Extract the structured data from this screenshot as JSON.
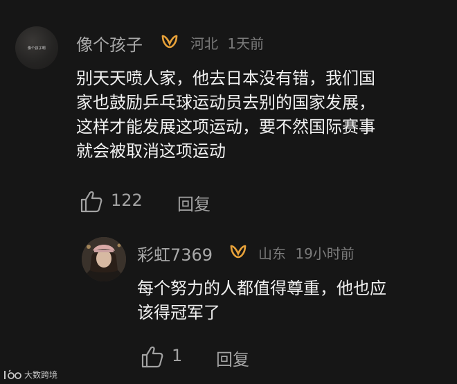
{
  "comment": {
    "username": "像个孩子",
    "location": "河北",
    "time": "1天前",
    "avatar_caption": "像个孩子啊",
    "text_lines": [
      "别天天喷人家，他去日本没有错，我们国",
      "家也鼓励乒乓球运动员去别的国家发展，",
      "这样才能发展这项运动，要不然国际赛事",
      "就会被取消这项运动"
    ],
    "like_count": "122",
    "reply_label": "回复"
  },
  "reply": {
    "username": "彩虹7369",
    "location": "山东",
    "time": "19小时前",
    "text_lines": [
      "每个努力的人都值得尊重，他也应",
      "该得冠军了"
    ],
    "like_count": "1",
    "reply_label": "回复"
  },
  "watermark": {
    "text": "大数跨境"
  },
  "colors": {
    "background": "#161616",
    "badge": "#e8a23a",
    "meta": "#7b7b7b",
    "username": "#a9a9a9",
    "body": "#f0f0f0"
  },
  "icons": {
    "badge": "vip-badge-icon",
    "like": "thumbs-up-icon"
  }
}
